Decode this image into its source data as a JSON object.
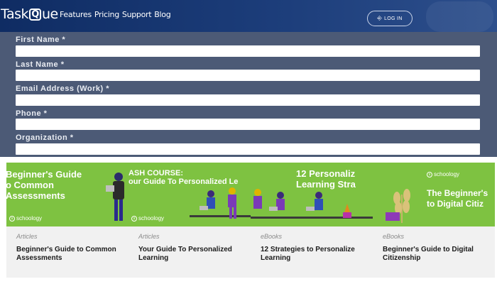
{
  "header": {
    "logo_prefix": "Task",
    "logo_q": "Q",
    "logo_suffix": "ue",
    "nav": [
      "Features",
      "Pricing",
      "Support",
      "Blog"
    ],
    "login_label": "LOG IN",
    "login_icon": "login-icon"
  },
  "form": {
    "fields": [
      {
        "label": "First Name *",
        "value": ""
      },
      {
        "label": "Last Name *",
        "value": ""
      },
      {
        "label": "Email Address (Work) *",
        "value": ""
      },
      {
        "label": "Phone *",
        "value": ""
      },
      {
        "label": "Organization *",
        "value": ""
      }
    ]
  },
  "cards": [
    {
      "banner_text": "Beginner's Guide\no Common\nAssessments",
      "brand": "schoology",
      "category": "Articles",
      "title": "Beginner's Guide to Common Assessments"
    },
    {
      "banner_text": "ASH COURSE:\nour Guide To Personalized Le",
      "brand": "schoology",
      "category": "Articles",
      "title": "Your Guide To Personalized Learning"
    },
    {
      "banner_text": "12 Personaliz\nLearning Stra",
      "brand": "",
      "category": "eBooks",
      "title": "12 Strategies to Personalize Learning"
    },
    {
      "banner_text": "The Beginner's\nto Digital Citiz",
      "brand": "schoology",
      "category": "eBooks",
      "title": "Beginner's Guide to Digital Citizenship"
    }
  ],
  "colors": {
    "header": "#1c3d7a",
    "form_bg": "#4c5a76",
    "banner_green": "#7ec241",
    "card_body": "#f1f1f1"
  }
}
